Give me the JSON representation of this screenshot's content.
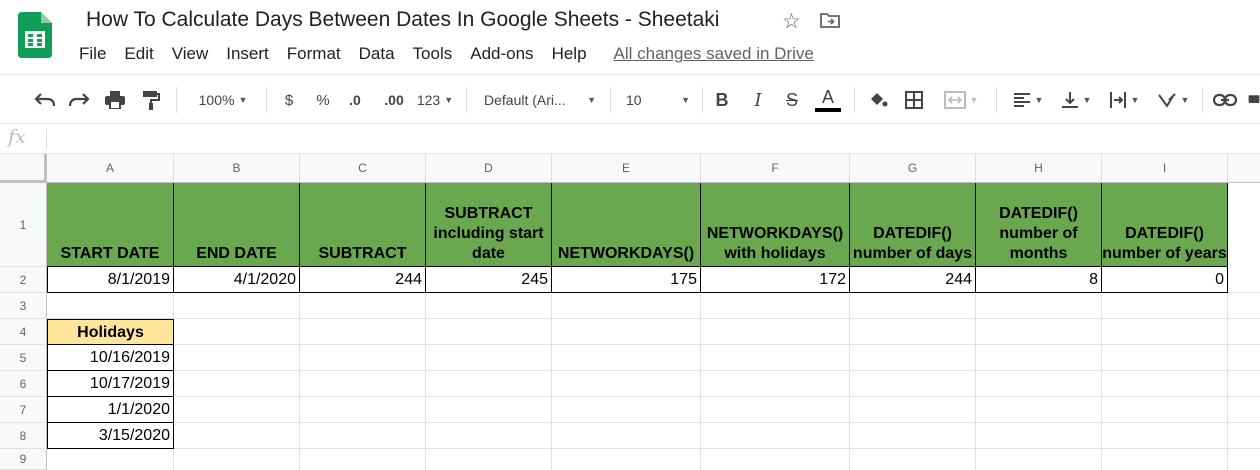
{
  "title": "How To Calculate Days Between Dates In Google Sheets - Sheetaki",
  "menu": [
    "File",
    "Edit",
    "View",
    "Insert",
    "Format",
    "Data",
    "Tools",
    "Add-ons",
    "Help"
  ],
  "saved_status": "All changes saved in Drive",
  "toolbar": {
    "zoom": "100%",
    "currency": "$",
    "percent": "%",
    "decrease_decimal": ".0",
    "increase_decimal": ".00",
    "more_formats": "123",
    "font": "Default (Ari...",
    "font_size": "10",
    "bold": "B",
    "italic": "I",
    "strike": "S",
    "text_color": "A"
  },
  "formula_bar": {
    "fx": "fx",
    "value": ""
  },
  "columns": [
    "A",
    "B",
    "C",
    "D",
    "E",
    "F",
    "G",
    "H",
    "I"
  ],
  "rows": [
    "1",
    "2",
    "3",
    "4",
    "5",
    "6",
    "7",
    "8",
    "9"
  ],
  "headers": {
    "A": "START DATE",
    "B": "END DATE",
    "C": "SUBTRACT",
    "D": "SUBTRACT including start date",
    "E": "NETWORKDAYS()",
    "F": "NETWORKDAYS() with holidays",
    "G": "DATEDIF() number of days",
    "H": "DATEDIF() number of months",
    "I": "DATEDIF() number of years"
  },
  "values": {
    "A": "8/1/2019",
    "B": "4/1/2020",
    "C": "244",
    "D": "245",
    "E": "175",
    "F": "172",
    "G": "244",
    "H": "8",
    "I": "0"
  },
  "holidays": {
    "label": "Holidays",
    "dates": [
      "10/16/2019",
      "10/17/2019",
      "1/1/2020",
      "3/15/2020"
    ]
  },
  "colors": {
    "header_green": "#6aa84f",
    "holiday_yellow": "#ffe599",
    "sheets_green": "#0f9d58"
  }
}
